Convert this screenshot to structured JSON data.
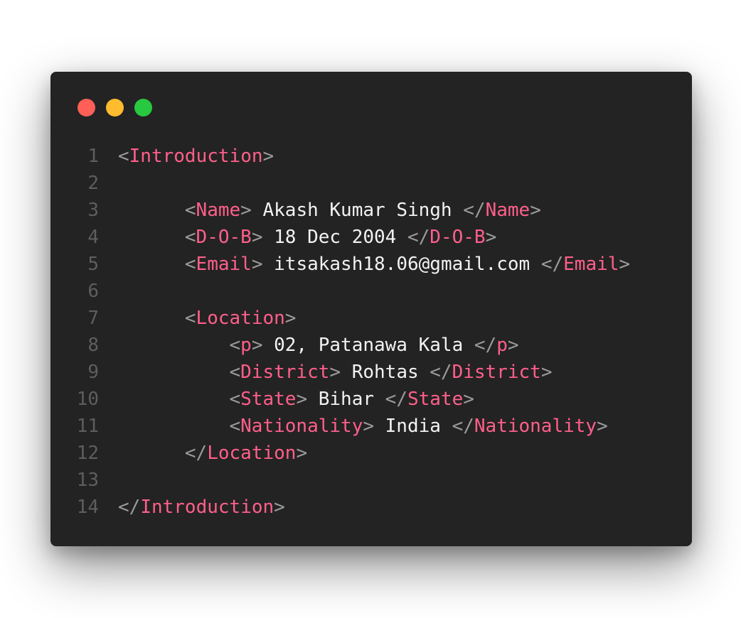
{
  "colors": {
    "window_bg": "#232323",
    "close": "#ff5f57",
    "minimize": "#febc2e",
    "maximize": "#28c840",
    "tag": "#ff5f8b",
    "bracket": "#9b9b9b",
    "value": "#f2f2f2",
    "line_number": "#5e5e5e"
  },
  "window_controls": [
    "close-dot",
    "minimize-dot",
    "maximize-dot"
  ],
  "lines": [
    {
      "n": "1",
      "indent": 0,
      "tokens": [
        [
          "br",
          "<"
        ],
        [
          "tag",
          "Introduction"
        ],
        [
          "br",
          ">"
        ]
      ]
    },
    {
      "n": "2",
      "indent": 0,
      "tokens": []
    },
    {
      "n": "3",
      "indent": 6,
      "tokens": [
        [
          "br",
          "<"
        ],
        [
          "tag",
          "Name"
        ],
        [
          "br",
          ">"
        ],
        [
          "val",
          " Akash Kumar Singh "
        ],
        [
          "br",
          "</"
        ],
        [
          "tag",
          "Name"
        ],
        [
          "br",
          ">"
        ]
      ]
    },
    {
      "n": "4",
      "indent": 6,
      "tokens": [
        [
          "br",
          "<"
        ],
        [
          "tag",
          "D-O-B"
        ],
        [
          "br",
          ">"
        ],
        [
          "val",
          " 18 Dec 2004 "
        ],
        [
          "br",
          "</"
        ],
        [
          "tag",
          "D-O-B"
        ],
        [
          "br",
          ">"
        ]
      ]
    },
    {
      "n": "5",
      "indent": 6,
      "tokens": [
        [
          "br",
          "<"
        ],
        [
          "tag",
          "Email"
        ],
        [
          "br",
          ">"
        ],
        [
          "val",
          " itsakash18.06@gmail.com "
        ],
        [
          "br",
          "</"
        ],
        [
          "tag",
          "Email"
        ],
        [
          "br",
          ">"
        ]
      ]
    },
    {
      "n": "6",
      "indent": 0,
      "tokens": []
    },
    {
      "n": "7",
      "indent": 6,
      "tokens": [
        [
          "br",
          "<"
        ],
        [
          "tag",
          "Location"
        ],
        [
          "br",
          ">"
        ]
      ]
    },
    {
      "n": "8",
      "indent": 10,
      "tokens": [
        [
          "br",
          "<"
        ],
        [
          "tag",
          "p"
        ],
        [
          "br",
          ">"
        ],
        [
          "val",
          " 02, Patanawa Kala "
        ],
        [
          "br",
          "</"
        ],
        [
          "tag",
          "p"
        ],
        [
          "br",
          ">"
        ]
      ]
    },
    {
      "n": "9",
      "indent": 10,
      "tokens": [
        [
          "br",
          "<"
        ],
        [
          "tag",
          "District"
        ],
        [
          "br",
          ">"
        ],
        [
          "val",
          " Rohtas "
        ],
        [
          "br",
          "</"
        ],
        [
          "tag",
          "District"
        ],
        [
          "br",
          ">"
        ]
      ]
    },
    {
      "n": "10",
      "indent": 10,
      "tokens": [
        [
          "br",
          "<"
        ],
        [
          "tag",
          "State"
        ],
        [
          "br",
          ">"
        ],
        [
          "val",
          " Bihar "
        ],
        [
          "br",
          "</"
        ],
        [
          "tag",
          "State"
        ],
        [
          "br",
          ">"
        ]
      ]
    },
    {
      "n": "11",
      "indent": 10,
      "tokens": [
        [
          "br",
          "<"
        ],
        [
          "tag",
          "Nationality"
        ],
        [
          "br",
          ">"
        ],
        [
          "val",
          " India "
        ],
        [
          "br",
          "</"
        ],
        [
          "tag",
          "Nationality"
        ],
        [
          "br",
          ">"
        ]
      ]
    },
    {
      "n": "12",
      "indent": 6,
      "tokens": [
        [
          "br",
          "</"
        ],
        [
          "tag",
          "Location"
        ],
        [
          "br",
          ">"
        ]
      ]
    },
    {
      "n": "13",
      "indent": 0,
      "tokens": []
    },
    {
      "n": "14",
      "indent": 0,
      "tokens": [
        [
          "br",
          "</"
        ],
        [
          "tag",
          "Introduction"
        ],
        [
          "br",
          ">"
        ]
      ]
    }
  ]
}
